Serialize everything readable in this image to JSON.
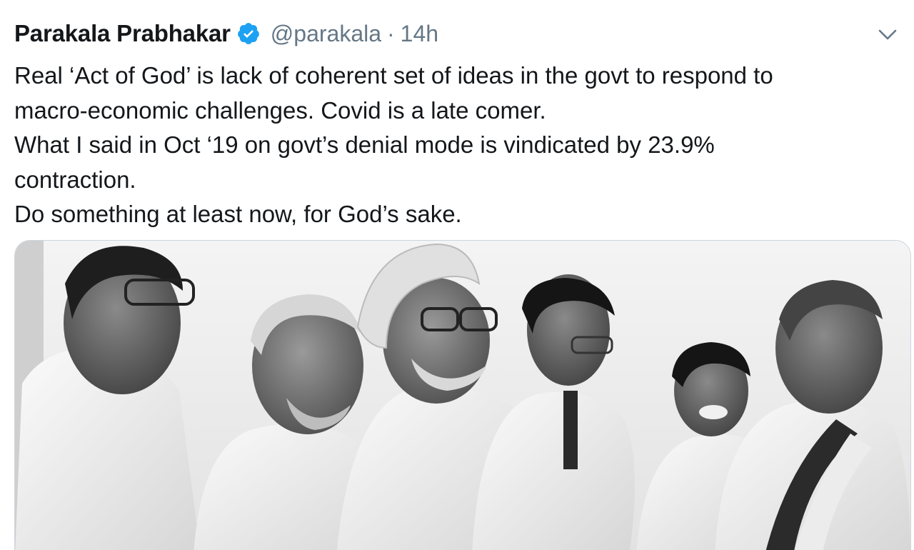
{
  "tweet": {
    "display_name": "Parakala Prabhakar",
    "handle": "@parakala",
    "separator": "·",
    "time": "14h",
    "verified_icon": "verified-badge-icon",
    "menu_icon": "chevron-down-icon",
    "lines": [
      "Real ‘Act of God’ is lack of coherent set of ideas in the govt to respond to",
      "macro-economic challenges. Covid is a late comer.",
      "What I said in Oct ‘19 on govt’s denial mode is vindicated by 23.9%",
      "contraction.",
      "Do something at least now, for God’s sake."
    ],
    "colors": {
      "verified": "#1da1f2",
      "secondary_text": "#657786",
      "primary_text": "#14171a"
    }
  }
}
